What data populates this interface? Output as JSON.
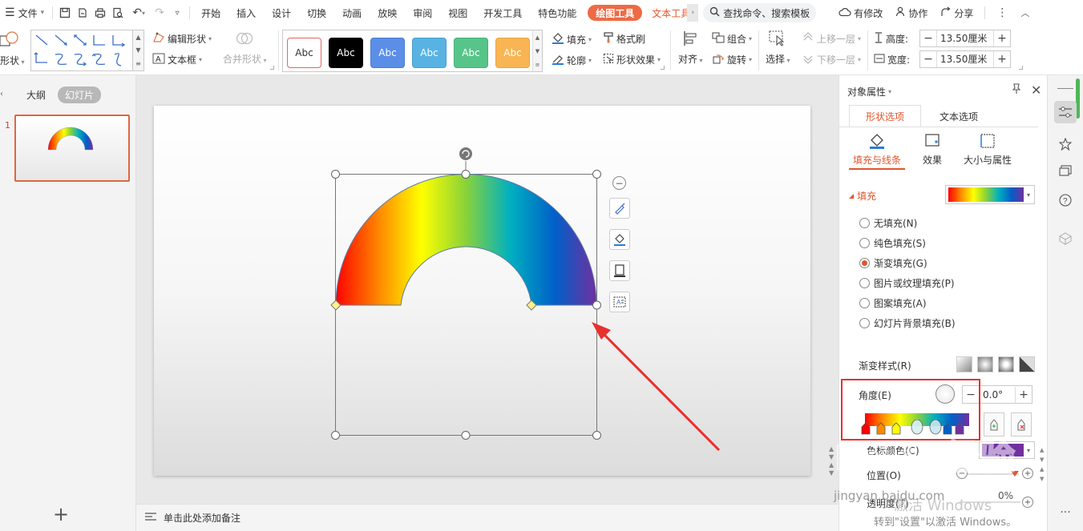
{
  "menu": {
    "file_label": "文件",
    "tabs": [
      "开始",
      "插入",
      "设计",
      "切换",
      "动画",
      "放映",
      "审阅",
      "视图",
      "开发工具",
      "特色功能"
    ],
    "drawing_tools": "绘图工具",
    "text_tools": "文本工具",
    "search_placeholder": "查找命令、搜索模板",
    "has_changes": "有修改",
    "collaborate": "协作",
    "share": "分享"
  },
  "ribbon": {
    "shape_label": "形状",
    "edit_shape": "编辑形状",
    "text_box": "文本框",
    "merge_shape": "合并形状",
    "style_swatches": [
      {
        "label": "Abc",
        "bg": "#ffffff",
        "fg": "#333333",
        "border": "#e06666"
      },
      {
        "label": "Abc",
        "bg": "#000000",
        "fg": "#ffffff",
        "border": "#000000"
      },
      {
        "label": "Abc",
        "bg": "#5b8ee6",
        "fg": "#ffffff",
        "border": "#4a7bd0"
      },
      {
        "label": "Abc",
        "bg": "#58b3e3",
        "fg": "#ffffff",
        "border": "#46a0d0"
      },
      {
        "label": "Abc",
        "bg": "#57c48a",
        "fg": "#ffffff",
        "border": "#45b078"
      },
      {
        "label": "Abc",
        "bg": "#f9b554",
        "fg": "#ffffff",
        "border": "#e8a440"
      }
    ],
    "fill": "填充",
    "format_painter": "格式刷",
    "outline": "轮廓",
    "shape_effect": "形状效果",
    "align": "对齐",
    "group": "组合",
    "rotate": "旋转",
    "select": "选择",
    "bring_forward": "上移一层",
    "send_backward": "下移一层",
    "height_label": "高度:",
    "height_value": "13.50厘米",
    "width_label": "宽度:",
    "width_value": "13.50厘米"
  },
  "left_panel": {
    "tab_outline": "大纲",
    "tab_slides": "幻灯片",
    "slide_number": "1"
  },
  "notes": {
    "placeholder": "单击此处添加备注"
  },
  "right_pane": {
    "title": "对象属性",
    "tab_shape": "形状选项",
    "tab_text": "文本选项",
    "sub_fill_line": "填充与线条",
    "sub_effect": "效果",
    "sub_size": "大小与属性",
    "fill_section": "填充",
    "fill_options": [
      {
        "label": "无填充(N)",
        "selected": false
      },
      {
        "label": "纯色填充(S)",
        "selected": false
      },
      {
        "label": "渐变填充(G)",
        "selected": true
      },
      {
        "label": "图片或纹理填充(P)",
        "selected": false
      },
      {
        "label": "图案填充(A)",
        "selected": false
      },
      {
        "label": "幻灯片背景填充(B)",
        "selected": false
      }
    ],
    "gradient_style": "渐变样式(R)",
    "angle_label": "角度(E)",
    "angle_value": "0.0°",
    "stop_color": "色标颜色(C)",
    "position_label": "位置(O)",
    "transparency_label": "透明度(T)",
    "transparency_value": "0%"
  },
  "watermark": {
    "site": "jingyan.baidu.com",
    "activate": "转到\"设置\"以激活 Windows。",
    "windows": "激活 Windows"
  },
  "colors": {
    "accent": "#e2552c",
    "rainbow": [
      "#ff0000",
      "#ff8a00",
      "#ffff00",
      "#8ad23a",
      "#00b0c0",
      "#0060c8",
      "#7030a0"
    ]
  }
}
